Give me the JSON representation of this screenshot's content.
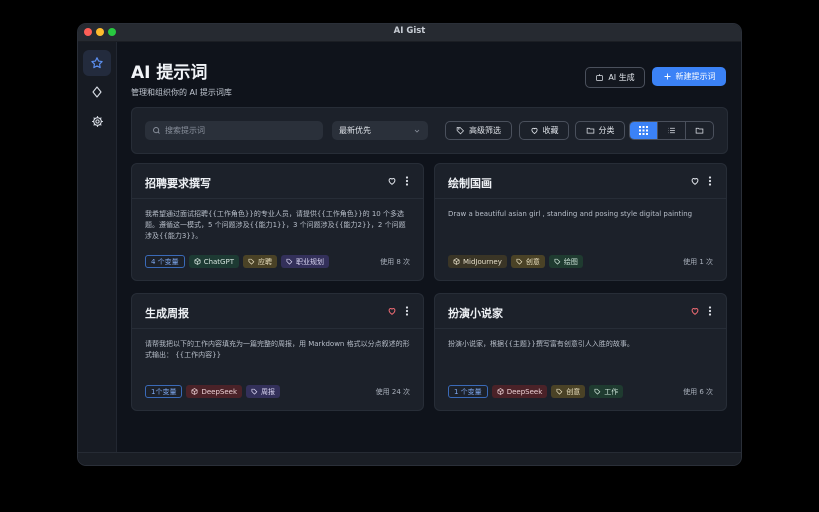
{
  "window": {
    "title": "AI Gist"
  },
  "header": {
    "title": "AI 提示词",
    "subtitle": "管理和组织你的 AI 提示词库",
    "ai_button": "AI 生成",
    "new_button": "新建提示词"
  },
  "toolbar": {
    "search_placeholder": "搜索提示词",
    "sort_value": "最新优先",
    "filter_label": "高级筛选",
    "favorites_label": "收藏",
    "category_label": "分类"
  },
  "cards": [
    {
      "title": "招聘要求撰写",
      "favorited": false,
      "body": "我希望通过面试招聘{{工作角色}}的专业人员，请提供{{工作角色}}的 10 个多选题。遵循这一模式，5 个问题涉及{{能力1}}，3 个问题涉及{{能力2}}，2 个问题涉及{{能力3}}。",
      "variables": "4 个变量",
      "model": "ChatGPT",
      "tags": [
        "应聘",
        "职业规划"
      ],
      "usage": "使用 8 次"
    },
    {
      "title": "绘制国画",
      "favorited": false,
      "body": "Draw a beautiful asian girl , standing and posing style digital painting",
      "model": "MidJourney",
      "tags": [
        "创意",
        "绘图"
      ],
      "usage": "使用 1 次"
    },
    {
      "title": "生成周报",
      "favorited": true,
      "body": "请帮我把以下的工作内容填充为一篇完整的周报，用 Markdown 格式以分点叙述的形式输出： {{工作内容}}",
      "variables": "1个变量",
      "model": "DeepSeek",
      "tags": [
        "周报"
      ],
      "usage": "使用 24 次"
    },
    {
      "title": "扮演小说家",
      "favorited": true,
      "body": "扮演小说家，根据{{主题}}撰写富有创意引人入胜的故事。",
      "variables": "1 个变量",
      "model": "DeepSeek",
      "tags": [
        "创意",
        "工作"
      ],
      "usage": "使用 6 次"
    }
  ],
  "colors": {
    "accent": "#3b82f6",
    "favorite": "#ef6b73"
  }
}
